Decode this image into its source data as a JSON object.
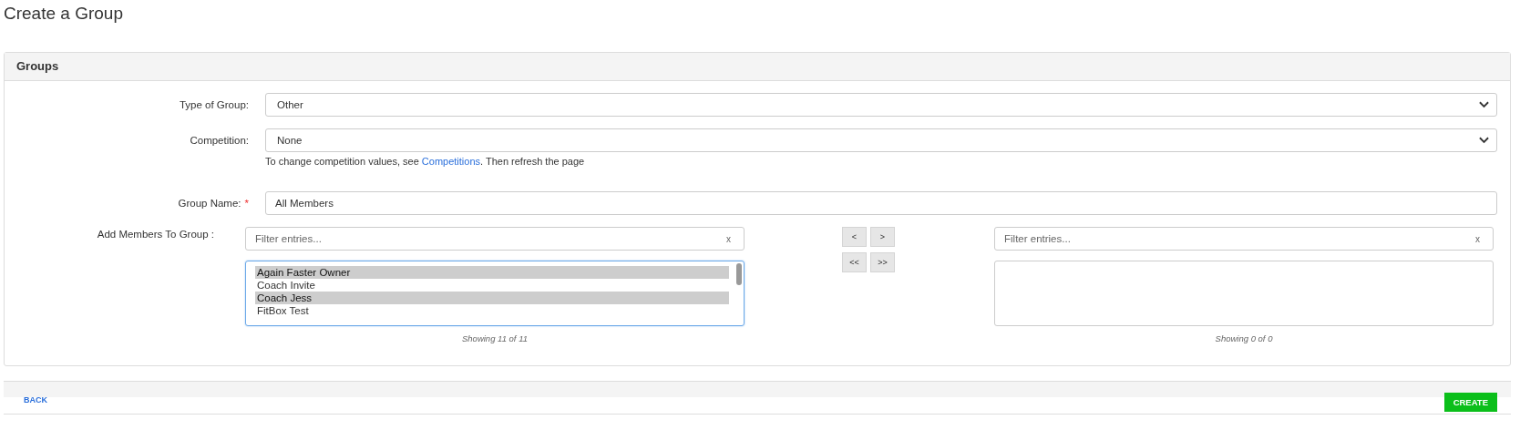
{
  "page_title": "Create a Group",
  "panel": {
    "title": "Groups",
    "fields": [
      {
        "kind": "select",
        "label": "Type of Group:",
        "value": "Other"
      },
      {
        "kind": "select",
        "label": "Competition:",
        "value": "None",
        "help": {
          "before": "To change competition values, see ",
          "link": "Competitions",
          "after": ". Then refresh the page"
        }
      },
      {
        "kind": "text",
        "label": "Group Name:",
        "value": "All Members",
        "required_mark": "*"
      }
    ],
    "members": {
      "label": "Add Members To Group :",
      "left": {
        "placeholder": "Filter entries...",
        "clear": "x",
        "items": [
          {
            "label": "Again Faster Owner",
            "selected": true
          },
          {
            "label": "Coach Invite",
            "selected": false
          },
          {
            "label": "Coach Jess",
            "selected": true
          },
          {
            "label": "FitBox Test",
            "selected": false
          }
        ],
        "count": "Showing 11 of 11"
      },
      "buttons": [
        "<",
        ">",
        "<<",
        ">>"
      ],
      "right": {
        "placeholder": "Filter entries...",
        "clear": "x",
        "count": "Showing 0 of 0"
      }
    }
  },
  "footer": {
    "back": "BACK",
    "create": "CREATE"
  }
}
